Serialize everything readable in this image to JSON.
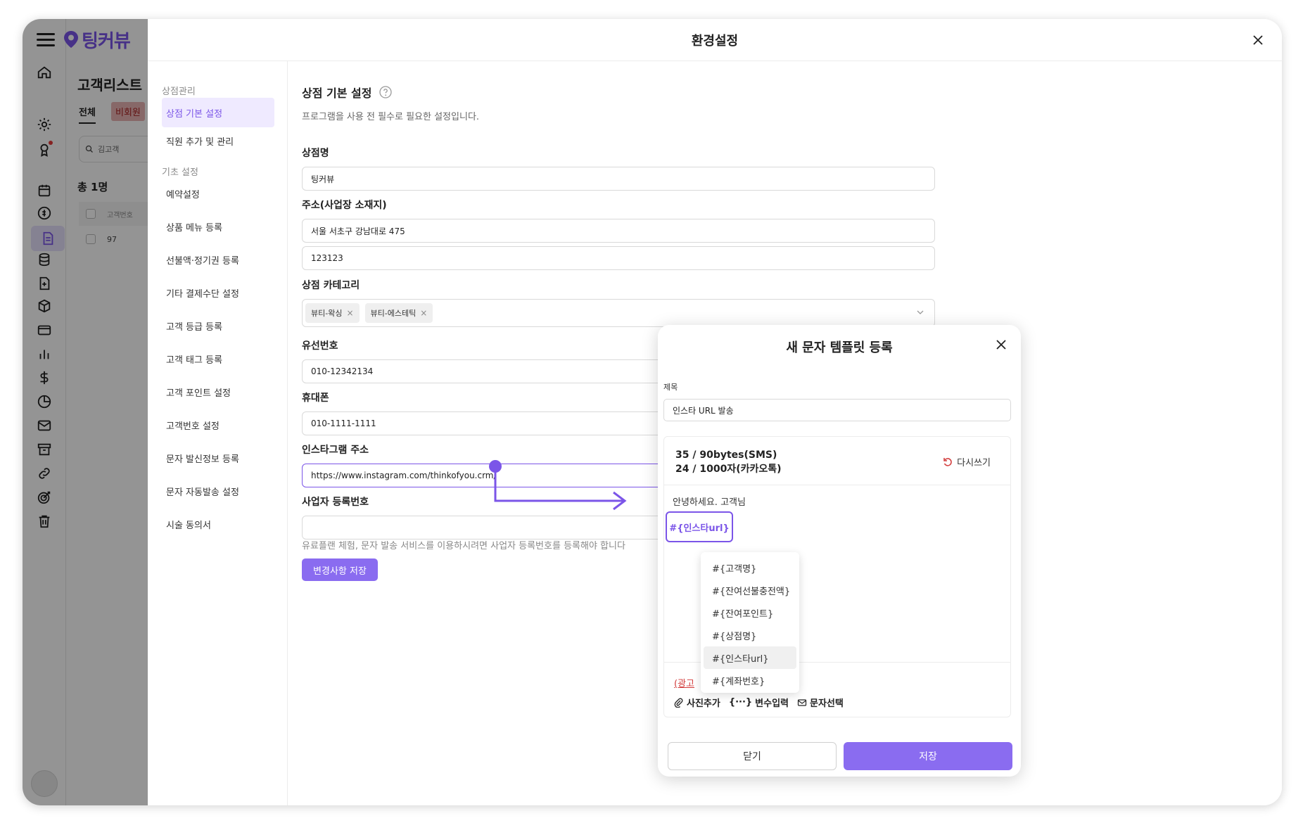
{
  "app": {
    "logo_text": "팅커뷰"
  },
  "background_page": {
    "title": "고객리스트",
    "tabs": [
      "전체",
      "비회원"
    ],
    "search_value": "김고객",
    "count": "총 1명",
    "table_header": "고객번호",
    "rows": [
      "97"
    ]
  },
  "settings": {
    "title": "환경설정",
    "sidebar": {
      "group1": "상점관리",
      "group1_items": [
        "상점 기본 설정",
        "직원 추가 및 관리"
      ],
      "group2": "기초 설정",
      "group2_items": [
        "예약설정",
        "상품 메뉴 등록",
        "선불액·정기권 등록",
        "기타 결제수단 설정",
        "고객 등급 등록",
        "고객 태그 등록",
        "고객 포인트 설정",
        "고객번호 설정",
        "문자 발신정보 등록",
        "문자 자동발송 설정",
        "시술 동의서"
      ]
    },
    "section_title": "상점 기본 설정",
    "section_desc": "프로그램을 사용 전 필수로 필요한 설정입니다.",
    "fields": {
      "store_name_label": "상점명",
      "store_name": "팅커뷰",
      "address_label": "주소(사업장 소재지)",
      "address1": "서울 서초구 강남대로 475",
      "address2": "123123",
      "category_label": "상점 카테고리",
      "categories": [
        "뷰티-왁싱",
        "뷰티-에스테틱"
      ],
      "landline_label": "유선번호",
      "landline": "010-12342134",
      "mobile_label": "휴대폰",
      "mobile": "010-1111-1111",
      "instagram_label": "인스타그램 주소",
      "instagram": "https://www.instagram.com/thinkofyou.crm/",
      "biz_no_label": "사업자 등록번호",
      "biz_no": "",
      "biz_hint": "유료플랜 체험, 문자 발송 서비스를 이용하시려면 사업자 등록번호를 등록해야 합니다"
    },
    "save_label": "변경사항 저장"
  },
  "modal": {
    "title": "새 문자 템플릿 등록",
    "subject_label": "제목",
    "subject_value": "인스타 URL 발송",
    "count_sms": "35 / 90bytes(SMS)",
    "count_kakao": "24 / 1000자(카카오톡)",
    "rewrite_label": "다시쓰기",
    "body_text": "안녕하세요. 고객님",
    "selected_var": "#{인스타url}",
    "variables": [
      "#{고객명}",
      "#{잔여선불충전액}",
      "#{잔여포인트}",
      "#{상점명}",
      "#{인스타url}",
      "#{계좌번호}"
    ],
    "ad_label": "(광고",
    "tools": {
      "photo": "사진추가",
      "var_glyph": "{···}",
      "var": "변수입력",
      "msg": "문자선택"
    },
    "close_label": "닫기",
    "save_label": "저장"
  },
  "colors": {
    "accent": "#7b55e8",
    "accent_btn": "#8a6cf0",
    "alert": "#d23a3a"
  }
}
